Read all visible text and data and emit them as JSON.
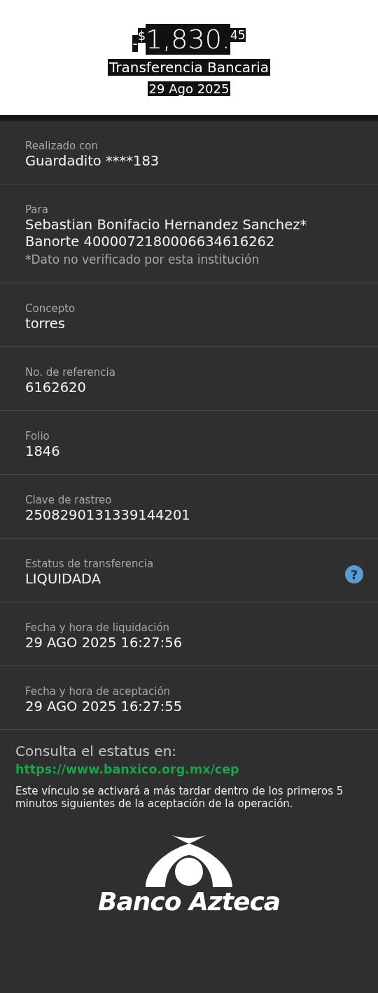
{
  "header": {
    "sign": "-",
    "currency": "$",
    "amount": "1,830.",
    "cents": "45",
    "title": "Transferencia Bancaria",
    "date": "29 Ago 2025"
  },
  "rows": [
    {
      "label": "Realizado con",
      "lines": [
        "Guardadito ****183"
      ]
    },
    {
      "label": "Para",
      "lines": [
        "Sebastian Bonifacio Hernandez Sanchez*",
        "Banorte 4000072180006634616262"
      ],
      "note": "*Dato no verificado por esta institución"
    },
    {
      "label": "Concepto",
      "lines": [
        "torres"
      ]
    },
    {
      "label": "No. de referencia",
      "lines": [
        "6162620"
      ]
    },
    {
      "label": "Folio",
      "lines": [
        "1846"
      ]
    },
    {
      "label": "Clave de rastreo",
      "lines": [
        "2508290131339144201"
      ]
    },
    {
      "label": "Estatus de transferencia",
      "lines": [
        "LIQUIDADA"
      ],
      "help_symbol": "?"
    },
    {
      "label": "Fecha y hora de liquidación",
      "lines": [
        "29 AGO 2025 16:27:56"
      ]
    },
    {
      "label": "Fecha y hora de aceptación",
      "lines": [
        "29 AGO 2025 16:27:55"
      ]
    }
  ],
  "footer": {
    "heading": "Consulta el estatus en:",
    "link": "https://www.banxico.org.mx/cep",
    "notice": "Este vínculo se activará a más tardar dentro de los primeros 5 minutos siguientes de la aceptación de la operación.",
    "brand": "Banco Azteca"
  }
}
